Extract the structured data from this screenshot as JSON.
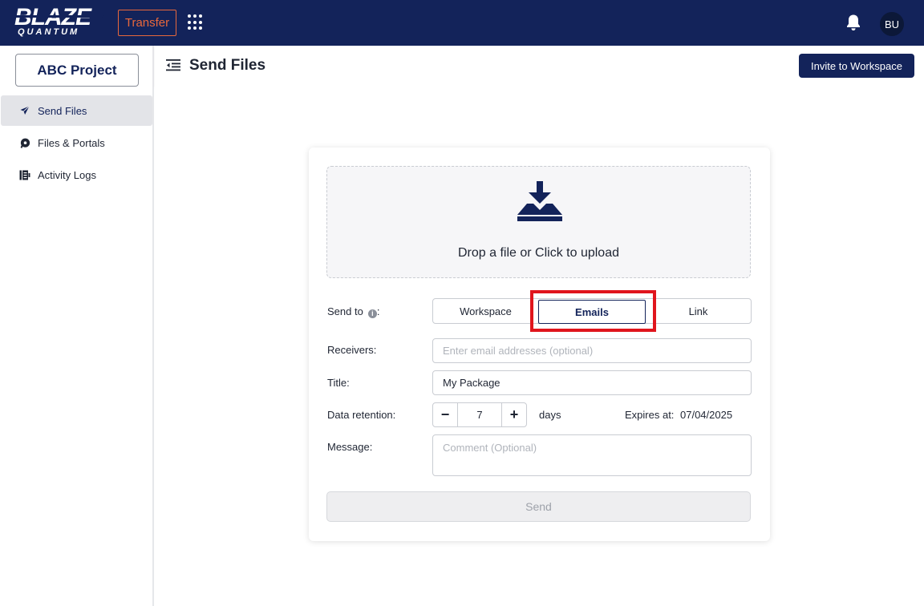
{
  "topbar": {
    "logo_main": "BLAZE",
    "logo_sub": "QUANTUM",
    "transfer_label": "Transfer",
    "avatar_initials": "BU"
  },
  "sidebar": {
    "project_label": "ABC Project",
    "items": [
      {
        "label": "Send Files",
        "icon": "send-icon",
        "active": true
      },
      {
        "label": "Files & Portals",
        "icon": "files-portals-icon",
        "active": false
      },
      {
        "label": "Activity Logs",
        "icon": "activity-logs-icon",
        "active": false
      }
    ]
  },
  "header": {
    "title": "Send Files",
    "invite_label": "Invite to Workspace"
  },
  "upload": {
    "drop_text": "Drop a file or Click to upload"
  },
  "form": {
    "send_to_label": "Send to",
    "send_to_options": [
      "Workspace",
      "Emails",
      "Link"
    ],
    "send_to_selected": "Emails",
    "receivers_label": "Receivers:",
    "receivers_placeholder": "Enter email addresses (optional)",
    "title_label": "Title:",
    "title_value": "My Package",
    "retention_label": "Data retention:",
    "retention_minus": "−",
    "retention_value": "7",
    "retention_plus": "+",
    "retention_unit": "days",
    "expires_label": "Expires at:",
    "expires_value": "07/04/2025",
    "message_label": "Message:",
    "message_placeholder": "Comment (Optional)",
    "send_label": "Send"
  },
  "colors": {
    "brand_navy": "#13235a",
    "accent_orange": "#e8683c",
    "highlight_red": "#e0151d"
  }
}
